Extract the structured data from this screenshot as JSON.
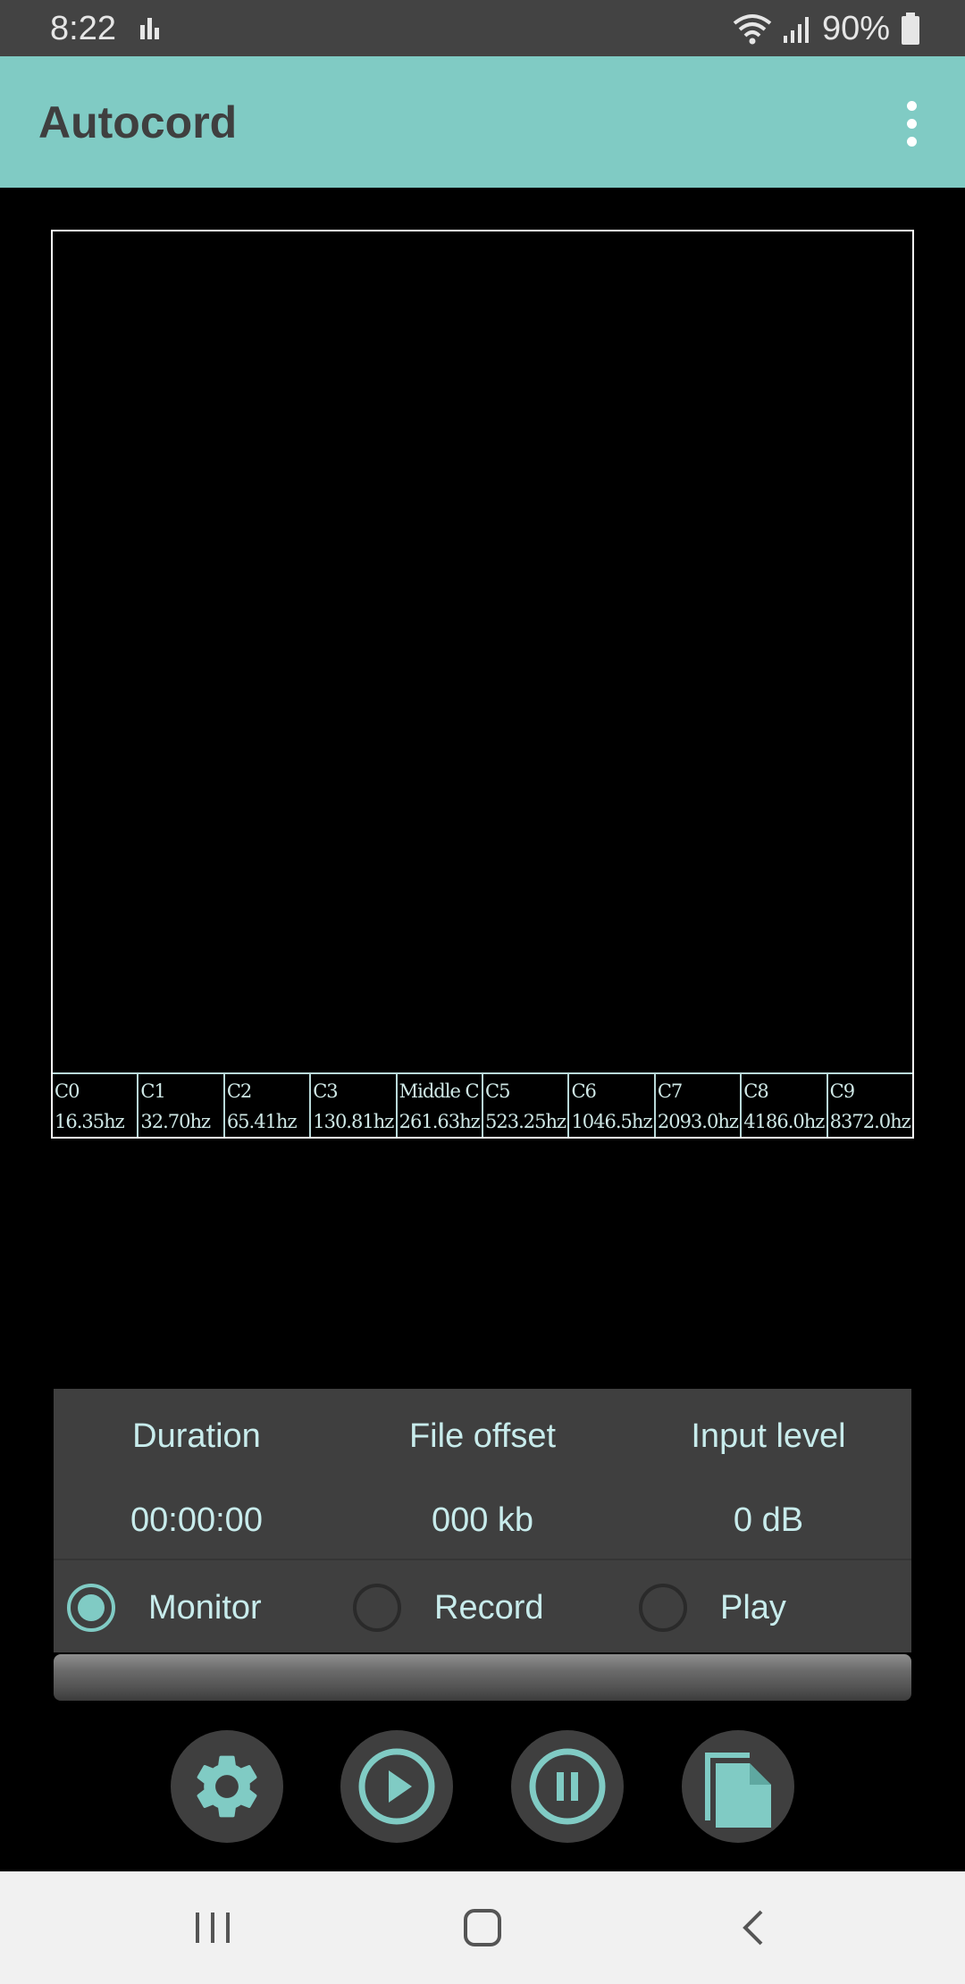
{
  "status_bar": {
    "time": "8:22",
    "battery": "90%",
    "icons": [
      "equalizer-icon",
      "wifi-icon",
      "signal-icon",
      "battery-icon"
    ]
  },
  "app_bar": {
    "title": "Autocord",
    "menu_icon": "more-vert-icon"
  },
  "spectrum": {
    "scale": [
      {
        "note": "C0",
        "freq": "16.35hz"
      },
      {
        "note": "C1",
        "freq": "32.70hz"
      },
      {
        "note": "C2",
        "freq": "65.41hz"
      },
      {
        "note": "C3",
        "freq": "130.81hz"
      },
      {
        "note": "Middle C",
        "freq": "261.63hz"
      },
      {
        "note": "C5",
        "freq": "523.25hz"
      },
      {
        "note": "C6",
        "freq": "1046.5hz"
      },
      {
        "note": "C7",
        "freq": "2093.0hz"
      },
      {
        "note": "C8",
        "freq": "4186.0hz"
      },
      {
        "note": "C9",
        "freq": "8372.0hz"
      }
    ]
  },
  "info": {
    "duration_label": "Duration",
    "duration_value": "00:00:00",
    "offset_label": "File offset",
    "offset_value": "000 kb",
    "level_label": "Input level",
    "level_value": "0 dB"
  },
  "modes": {
    "selected": "Monitor",
    "monitor": "Monitor",
    "record": "Record",
    "play": "Play"
  },
  "progress": {
    "fraction": 0
  },
  "actions": [
    "gear-icon",
    "play-circle-icon",
    "pause-circle-icon",
    "file-icon"
  ],
  "colors": {
    "accent": "#80cbc4",
    "panel": "#3f3f3f",
    "status_bar": "#434343",
    "background": "#000000"
  }
}
